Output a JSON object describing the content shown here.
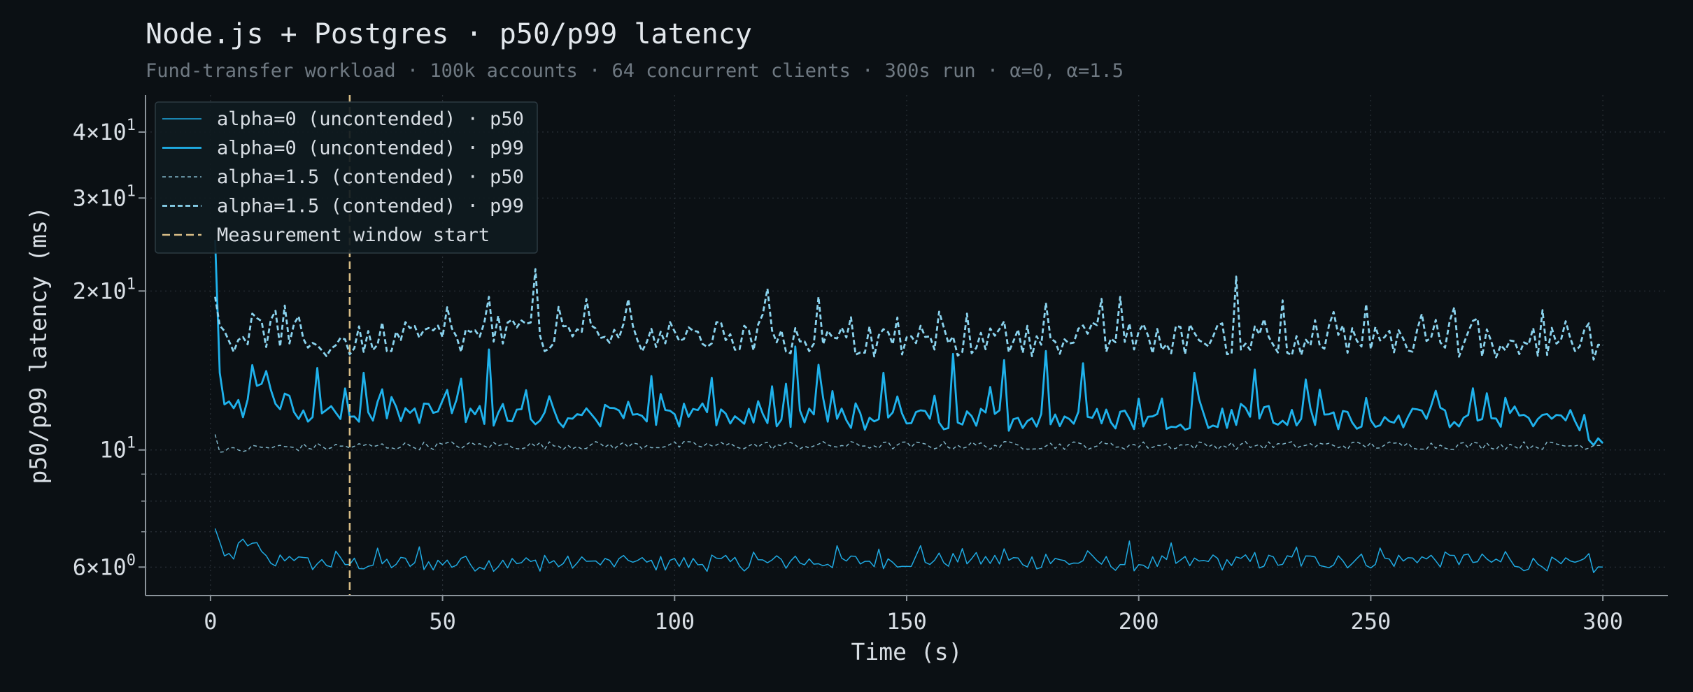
{
  "chart_data": {
    "type": "line",
    "title": "Node.js + Postgres · p50/p99 latency",
    "subtitle": "Fund-transfer workload · 100k accounts · 64 concurrent clients · 300s run · α=0, α=1.5",
    "xlabel": "Time (s)",
    "ylabel": "p50/p99 latency (ms)",
    "xlim": [
      -14,
      314
    ],
    "ylim": [
      5.3,
      47
    ],
    "yscale": "log",
    "grid": true,
    "legend_position": "top-left",
    "x_ticks": [
      0,
      50,
      100,
      150,
      200,
      250,
      300
    ],
    "y_ticks": [
      {
        "value": 6,
        "mantissa": "6",
        "exponent": "0"
      },
      {
        "value": 10,
        "mantissa": "10",
        "exponent": "1"
      },
      {
        "value": 20,
        "mantissa": "2",
        "exponent": "1"
      },
      {
        "value": 30,
        "mantissa": "3",
        "exponent": "1"
      },
      {
        "value": 40,
        "mantissa": "4",
        "exponent": "1"
      }
    ],
    "y_times_glyph": "×",
    "series_x": {
      "start": 1,
      "end": 300,
      "step": 1
    },
    "series": [
      {
        "name": "alpha=0 (uncontended) · p50",
        "color": "#1fa9e1",
        "style": "solid",
        "width": "thin",
        "keypoints": [
          [
            1,
            7.1
          ],
          [
            3,
            6.3
          ],
          [
            5,
            6.3
          ],
          [
            6,
            6.6
          ],
          [
            8,
            6.5
          ],
          [
            10,
            6.5
          ],
          [
            13,
            6.0
          ],
          [
            16,
            6.3
          ],
          [
            20,
            6.1
          ],
          [
            25,
            6.1
          ],
          [
            30,
            6.1
          ],
          [
            60,
            6.1
          ],
          [
            110,
            6.1
          ],
          [
            160,
            6.2
          ],
          [
            200,
            6.1
          ],
          [
            265,
            6.2
          ],
          [
            300,
            6.0
          ]
        ],
        "base": 6.15,
        "noise": 0.035,
        "spike_every": 9,
        "spike": 0.07
      },
      {
        "name": "alpha=0 (uncontended) · p99",
        "color": "#1fb2ec",
        "style": "solid",
        "width": "thick",
        "keypoints": [
          [
            1,
            25
          ],
          [
            2,
            14
          ],
          [
            3,
            12.2
          ],
          [
            5,
            11.8
          ],
          [
            7,
            12.1
          ],
          [
            9,
            13.8
          ],
          [
            11,
            12.8
          ],
          [
            15,
            12.5
          ],
          [
            20,
            11.8
          ],
          [
            30,
            11.9
          ],
          [
            60,
            11.7
          ],
          [
            100,
            11.5
          ],
          [
            150,
            11.4
          ],
          [
            200,
            11.5
          ],
          [
            250,
            11.5
          ],
          [
            280,
            11.6
          ],
          [
            295,
            11.4
          ],
          [
            300,
            10.3
          ]
        ],
        "base": 11.5,
        "noise": 0.05,
        "spikes": [
          [
            23,
            14.3
          ],
          [
            33,
            14.0
          ],
          [
            60,
            15.5
          ],
          [
            95,
            13.8
          ],
          [
            108,
            13.7
          ],
          [
            126,
            15.7
          ],
          [
            131,
            14.5
          ],
          [
            145,
            14.0
          ],
          [
            160,
            15.2
          ],
          [
            171,
            14.8
          ],
          [
            180,
            15.4
          ],
          [
            188,
            14.6
          ],
          [
            212,
            14.0
          ],
          [
            225,
            14.2
          ],
          [
            236,
            13.6
          ]
        ]
      },
      {
        "name": "alpha=1.5 (contended) · p50",
        "color": "#7fb3c6",
        "style": "dashed",
        "width": "thin",
        "keypoints": [
          [
            1,
            10.7
          ],
          [
            2,
            9.9
          ],
          [
            10,
            10.1
          ],
          [
            50,
            10.2
          ],
          [
            100,
            10.2
          ],
          [
            150,
            10.2
          ],
          [
            200,
            10.2
          ],
          [
            250,
            10.2
          ],
          [
            300,
            10.2
          ]
        ],
        "base": 10.2,
        "noise": 0.018
      },
      {
        "name": "alpha=1.5 (contended) · p99",
        "color": "#8ad3ee",
        "style": "dashed",
        "width": "thick",
        "keypoints": [
          [
            1,
            19.5
          ],
          [
            2,
            17.2
          ],
          [
            5,
            16.0
          ],
          [
            10,
            17.0
          ],
          [
            20,
            15.8
          ],
          [
            40,
            16.3
          ],
          [
            60,
            16.5
          ],
          [
            100,
            16.5
          ],
          [
            150,
            16.0
          ],
          [
            200,
            16.3
          ],
          [
            250,
            16.2
          ],
          [
            290,
            16.0
          ],
          [
            300,
            15.8
          ]
        ],
        "base": 16.2,
        "noise": 0.07,
        "spikes": [
          [
            70,
            22.0
          ],
          [
            60,
            19.5
          ],
          [
            90,
            19.3
          ],
          [
            120,
            20.2
          ],
          [
            131,
            19.5
          ],
          [
            180,
            19.0
          ],
          [
            196,
            19.5
          ],
          [
            221,
            21.3
          ],
          [
            231,
            19.2
          ],
          [
            287,
            18.4
          ]
        ]
      }
    ],
    "markers": [
      {
        "name": "Measurement window start",
        "x": 30,
        "color": "#d8bd86",
        "style": "dashed"
      }
    ]
  }
}
